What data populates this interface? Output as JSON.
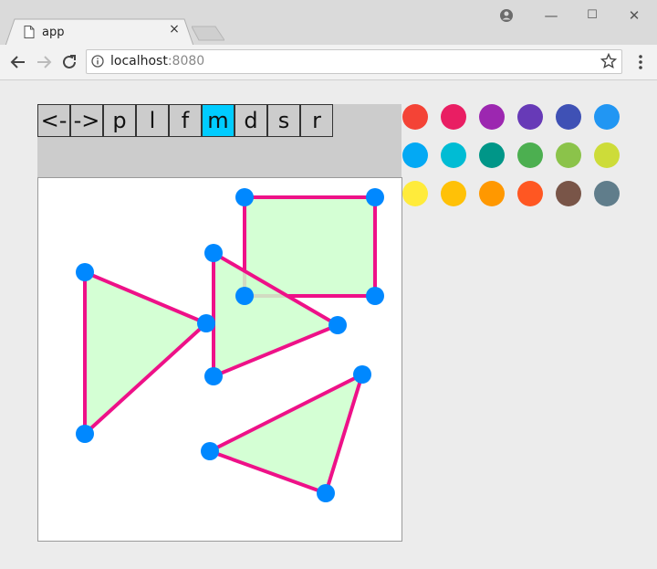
{
  "browser": {
    "tab_title": "app",
    "tab_close": "×",
    "url_host": "localhost",
    "url_port": ":8080",
    "window_minimize": "—",
    "window_maximize": "☐",
    "window_close": "✕"
  },
  "toolbar": {
    "buttons": [
      {
        "label": "<-",
        "active": false
      },
      {
        "label": "->",
        "active": false
      },
      {
        "label": "p",
        "active": false
      },
      {
        "label": "l",
        "active": false
      },
      {
        "label": "f",
        "active": false
      },
      {
        "label": "m",
        "active": true
      },
      {
        "label": "d",
        "active": false
      },
      {
        "label": "s",
        "active": false
      },
      {
        "label": "r",
        "active": false
      }
    ],
    "active_color": "#00ccff"
  },
  "palette": {
    "colors": [
      "#f44336",
      "#e91e63",
      "#9c27b0",
      "#673ab7",
      "#3f51b5",
      "#2196f3",
      "#03a9f4",
      "#00bcd4",
      "#009688",
      "#4caf50",
      "#8bc34a",
      "#cddc39",
      "#ffeb3b",
      "#ffc107",
      "#ff9800",
      "#ff5722",
      "#795548",
      "#607d8b"
    ]
  },
  "drawing": {
    "fill_color": "#ccffcc",
    "stroke_color": "#ee1188",
    "vertex_color": "#0088ff"
  }
}
